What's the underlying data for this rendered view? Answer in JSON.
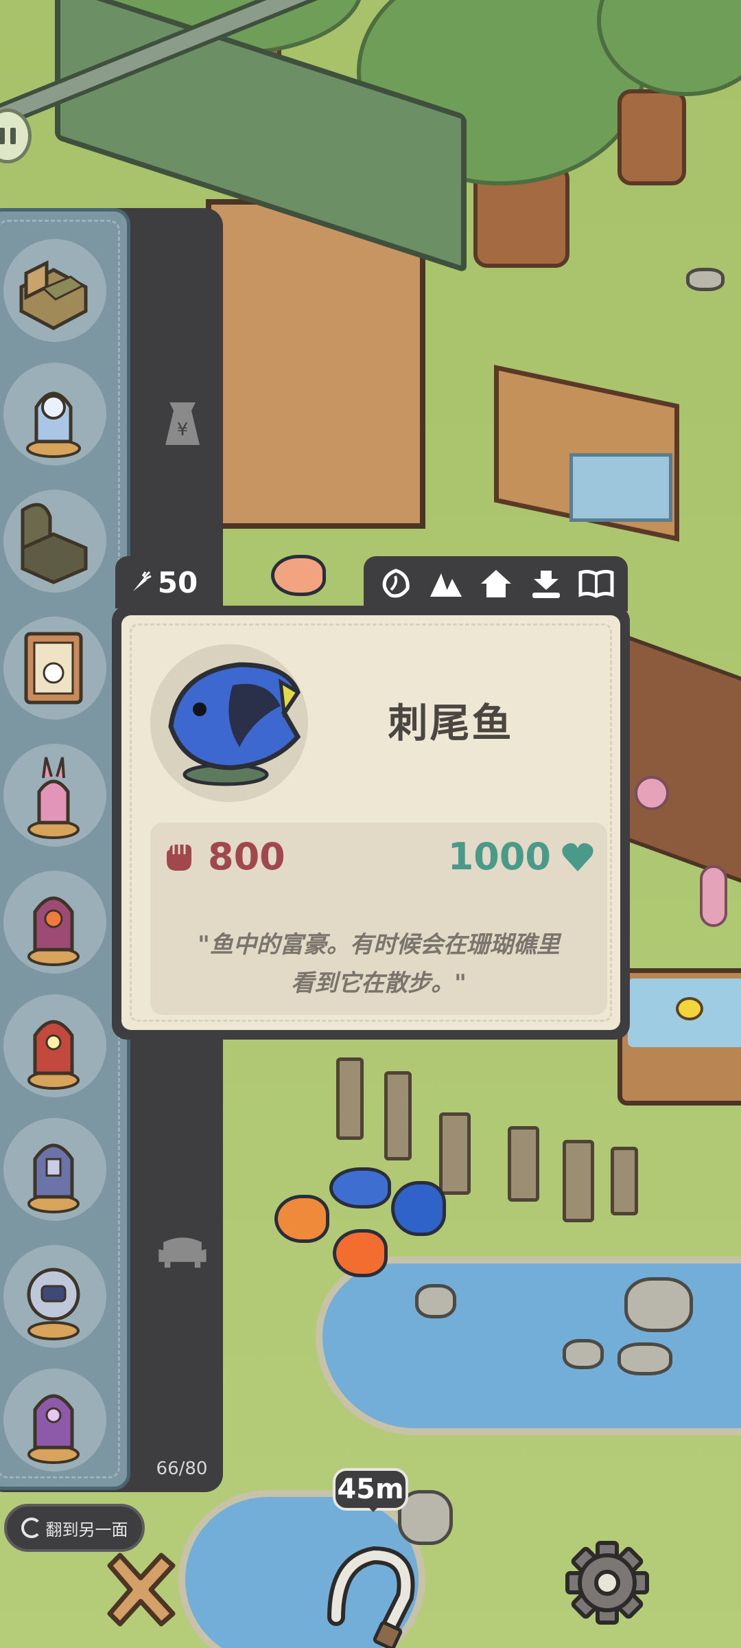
{
  "pause": {
    "icon": "pause-icon"
  },
  "side_panel": {
    "items": [
      {
        "icon": "bed-icon",
        "color": "#8a7a4e"
      },
      {
        "icon": "ice-knight-figure-icon",
        "color": "#a9c6e6"
      },
      {
        "icon": "dark-bed-icon",
        "color": "#6b6a4c"
      },
      {
        "icon": "rabbit-portrait-icon",
        "color": "#c98b59"
      },
      {
        "icon": "pink-rabbit-figure-icon",
        "color": "#e294b9"
      },
      {
        "icon": "purple-warrior-figure-icon",
        "color": "#9d4a74"
      },
      {
        "icon": "red-demon-figure-icon",
        "color": "#c3483e"
      },
      {
        "icon": "blue-knight-figure-icon",
        "color": "#6b73a8"
      },
      {
        "icon": "robot-figure-icon",
        "color": "#bfc8da"
      },
      {
        "icon": "violet-mage-figure-icon",
        "color": "#8c5aa8"
      }
    ],
    "tabs": [
      {
        "icon": "seed-bag-icon"
      },
      {
        "icon": "sofa-icon"
      }
    ],
    "count": "66/80",
    "flip_button": "翻到另一面"
  },
  "carrot": {
    "icon": "carrot-icon",
    "value": "50"
  },
  "card_toolbar": {
    "buttons": [
      {
        "icon": "shell-icon"
      },
      {
        "icon": "mountain-icon"
      },
      {
        "icon": "house-icon"
      },
      {
        "icon": "download-icon"
      },
      {
        "icon": "book-icon"
      }
    ]
  },
  "card": {
    "name": "刺尾鱼",
    "portrait_icon": "blue-tang-fish-icon",
    "cost": {
      "icon": "fist-icon",
      "value": "800"
    },
    "reward": {
      "icon": "heart-icon",
      "value": "1000"
    },
    "description_line1": "\"鱼中的富豪。有时候会在珊瑚礁里",
    "description_line2": "看到它在散步。\""
  },
  "bottom": {
    "close_icon": "close-icon",
    "distance": "45m",
    "hook_icon": "fishing-hook-icon",
    "settings_icon": "gear-icon"
  }
}
